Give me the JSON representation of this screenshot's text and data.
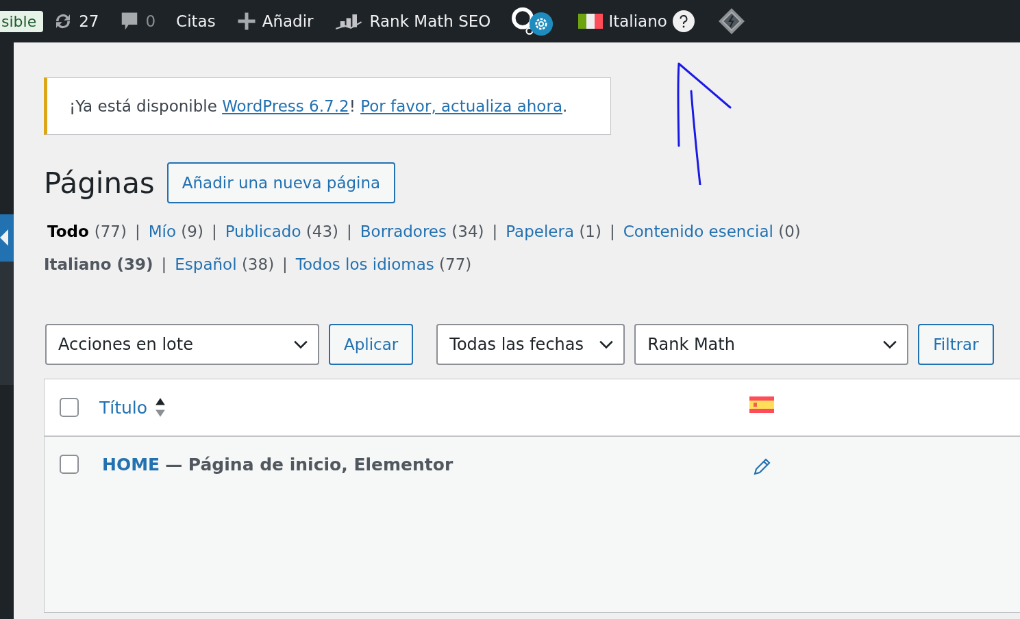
{
  "admin_bar": {
    "items": [
      {
        "kind": "badge",
        "label": "sible"
      },
      {
        "kind": "updates",
        "label": "27"
      },
      {
        "kind": "comments",
        "label": "0"
      },
      {
        "kind": "text",
        "label": "Citas"
      },
      {
        "kind": "add",
        "label": "Añadir"
      },
      {
        "kind": "rankmath",
        "label": "Rank Math SEO"
      },
      {
        "kind": "plugins"
      },
      {
        "kind": "language",
        "label": "Italiano"
      },
      {
        "kind": "diamond"
      }
    ]
  },
  "notice": {
    "segments": [
      {
        "kind": "text",
        "text": "¡Ya está disponible "
      },
      {
        "kind": "link",
        "text": "WordPress 6.7.2"
      },
      {
        "kind": "text",
        "text": "! "
      },
      {
        "kind": "link",
        "text": "Por favor, actualiza ahora"
      },
      {
        "kind": "text",
        "text": "."
      }
    ]
  },
  "heading": {
    "title": "Páginas",
    "add_button": "Añadir una nueva página"
  },
  "views": {
    "separator": "|",
    "items": [
      {
        "label": "Todo",
        "count": "(77)",
        "selected": true
      },
      {
        "label": "Mío",
        "count": "(9)",
        "selected": false
      },
      {
        "label": "Publicado",
        "count": "(43)",
        "selected": false
      },
      {
        "label": "Borradores",
        "count": "(34)",
        "selected": false
      },
      {
        "label": "Papelera",
        "count": "(1)",
        "selected": false
      },
      {
        "label": "Contenido esencial",
        "count": "(0)",
        "selected": false
      }
    ]
  },
  "language_views": {
    "separator": "|",
    "items": [
      {
        "label": "Italiano",
        "count": "(39)",
        "selected": true
      },
      {
        "label": "Español",
        "count": "(38)",
        "selected": false
      },
      {
        "label": "Todos los idiomas",
        "count": "(77)",
        "selected": false
      }
    ]
  },
  "toolbar": {
    "bulk_actions": "Acciones en lote",
    "apply": "Aplicar",
    "dates": "Todas las fechas",
    "seo_filter": "Rank Math",
    "filter": "Filtrar"
  },
  "table": {
    "select_all_checked": false,
    "title_column": "Título",
    "rows": [
      {
        "title": "HOME",
        "state": "— Página de inicio, Elementor",
        "checked": false
      }
    ]
  }
}
